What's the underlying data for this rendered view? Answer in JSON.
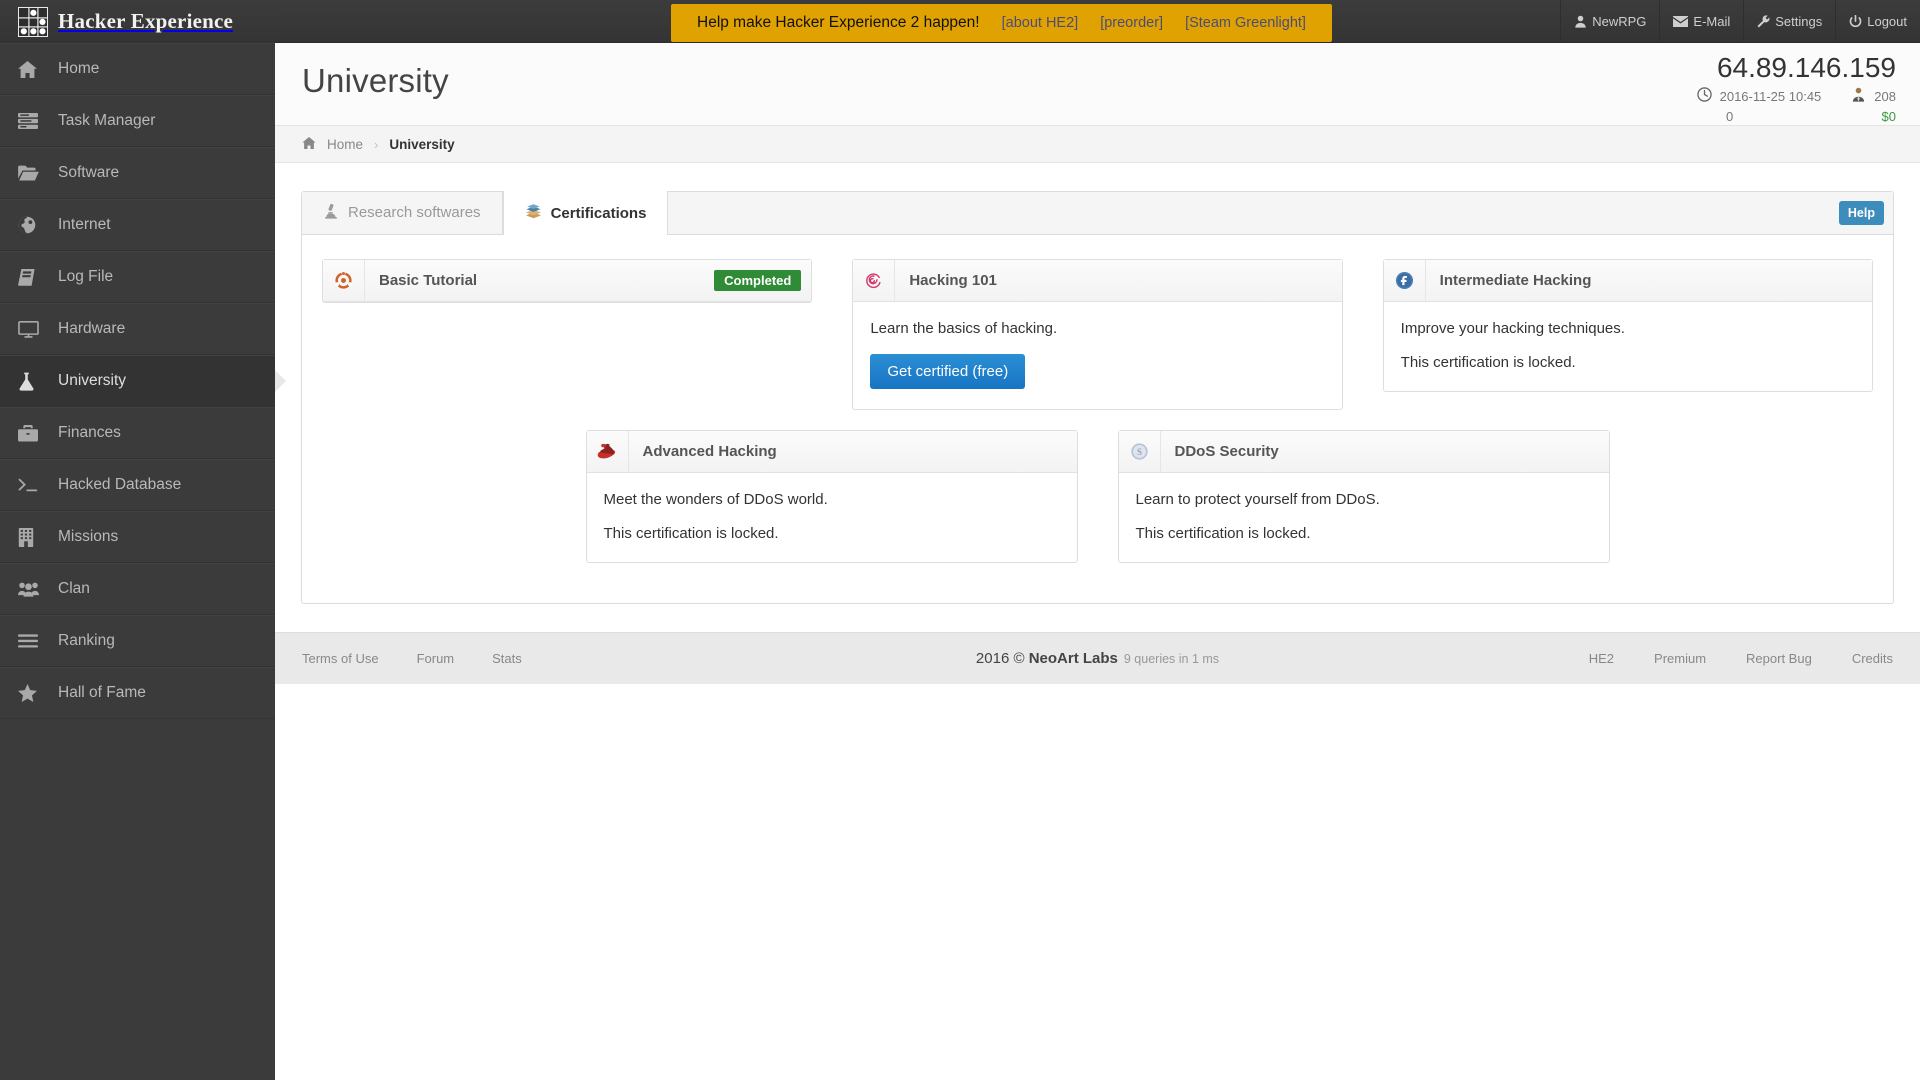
{
  "brand": {
    "name": "Hacker Experience",
    "logo_icon": "grid-logo-icon"
  },
  "promo": {
    "text": "Help make Hacker Experience 2 happen!",
    "links": [
      {
        "label": "[about HE2]"
      },
      {
        "label": "[preorder]"
      },
      {
        "label": "[Steam Greenlight]"
      }
    ]
  },
  "topnav": [
    {
      "label": "NewRPG",
      "icon": "user-icon"
    },
    {
      "label": "E-Mail",
      "icon": "envelope-icon"
    },
    {
      "label": "Settings",
      "icon": "wrench-icon"
    },
    {
      "label": "Logout",
      "icon": "power-icon"
    }
  ],
  "sidebar": {
    "items": [
      {
        "label": "Home",
        "icon": "home-icon",
        "active": false
      },
      {
        "label": "Task Manager",
        "icon": "tasks-icon",
        "active": false
      },
      {
        "label": "Software",
        "icon": "folder-open-icon",
        "active": false
      },
      {
        "label": "Internet",
        "icon": "globe-icon",
        "active": false
      },
      {
        "label": "Log File",
        "icon": "book-icon",
        "active": false
      },
      {
        "label": "Hardware",
        "icon": "desktop-icon",
        "active": false
      },
      {
        "label": "University",
        "icon": "flask-icon",
        "active": true
      },
      {
        "label": "Finances",
        "icon": "briefcase-icon",
        "active": false
      },
      {
        "label": "Hacked Database",
        "icon": "terminal-icon",
        "active": false
      },
      {
        "label": "Missions",
        "icon": "building-icon",
        "active": false
      },
      {
        "label": "Clan",
        "icon": "users-icon",
        "active": false
      },
      {
        "label": "Ranking",
        "icon": "bars-icon",
        "active": false
      },
      {
        "label": "Hall of Fame",
        "icon": "star-icon",
        "active": false
      }
    ]
  },
  "page": {
    "title": "University",
    "stats": {
      "ip": "64.89.146.159",
      "clock_icon": "clock-icon",
      "datetime": "2016-11-25 10:45",
      "reputation_icon": "user-tie-icon",
      "reputation": "208",
      "left_value": "0",
      "money": "$0"
    }
  },
  "breadcrumb": {
    "home_icon": "home-icon",
    "home": "Home",
    "separator": "›",
    "current": "University"
  },
  "tabs": [
    {
      "label": "Research softwares",
      "icon": "microscope-icon",
      "active": false
    },
    {
      "label": "Certifications",
      "icon": "books-icon",
      "active": true
    }
  ],
  "help_button": {
    "label": "Help"
  },
  "certifications": {
    "row1": [
      {
        "title": "Basic Tutorial",
        "icon": "ubuntu-circle-icon",
        "badge": "Completed",
        "badge_color": "#2f8b35",
        "body": [],
        "action": null
      },
      {
        "title": "Hacking 101",
        "icon": "debian-spiral-icon",
        "badge": null,
        "body": [
          "Learn the basics of hacking."
        ],
        "action": {
          "label": "Get certified (free)",
          "color": "#1874c4"
        }
      },
      {
        "title": "Intermediate Hacking",
        "icon": "fedora-circle-icon",
        "badge": null,
        "body": [
          "Improve your hacking techniques.",
          "This certification is locked."
        ],
        "action": null
      }
    ],
    "row2": [
      {
        "title": "Advanced Hacking",
        "icon": "redhat-icon",
        "badge": null,
        "body": [
          "Meet the wonders of DDoS world.",
          "This certification is locked."
        ],
        "action": null
      },
      {
        "title": "DDoS Security",
        "icon": "suse-circle-icon",
        "badge": null,
        "body": [
          "Learn to protect yourself from DDoS.",
          "This certification is locked."
        ],
        "action": null
      }
    ]
  },
  "footer": {
    "left": [
      {
        "label": "Terms of Use"
      },
      {
        "label": "Forum"
      },
      {
        "label": "Stats"
      }
    ],
    "center_year": "2016 © ",
    "center_brand": "NeoArt Labs",
    "center_queries": "9 queries in 1 ms",
    "right": [
      {
        "label": "HE2"
      },
      {
        "label": "Premium"
      },
      {
        "label": "Report Bug"
      },
      {
        "label": "Credits"
      }
    ]
  }
}
